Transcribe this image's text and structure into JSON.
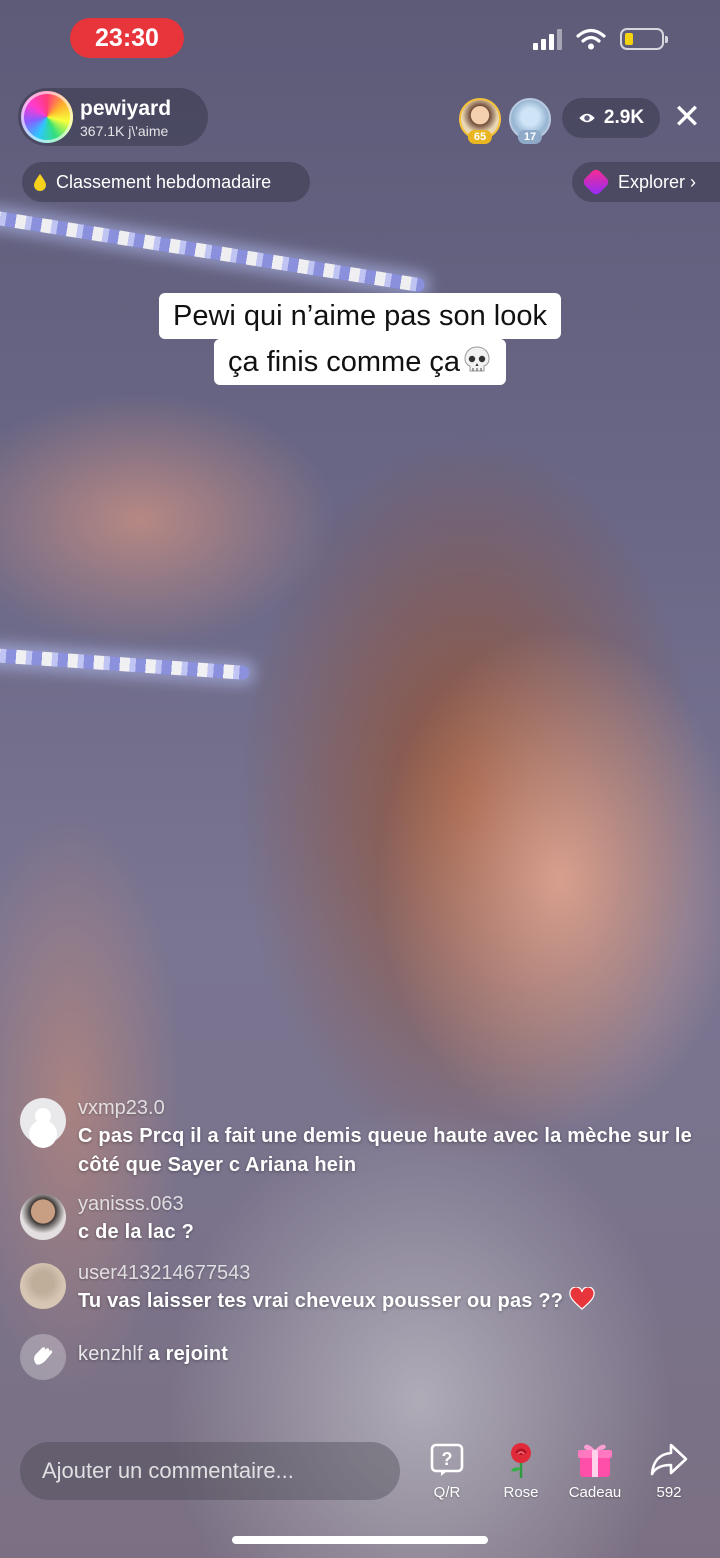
{
  "status_bar": {
    "time": "23:30"
  },
  "host": {
    "name": "pewiyard",
    "likes": "367.1K j\\'aime"
  },
  "top_viewers": [
    {
      "badge": "65"
    },
    {
      "badge": "17"
    }
  ],
  "viewer_count": "2.9K",
  "ranking_label": "Classement hebdomadaire",
  "explore_label": "Explorer ›",
  "caption": {
    "line1": "Pewi qui n’aime pas son look",
    "line2": "ça finis comme ça"
  },
  "comments": [
    {
      "user": "vxmp23.0",
      "text": "C pas Prcq il a fait une demis queue haute avec la mèche sur le côté que Sayer c Ariana hein"
    },
    {
      "user": "yanisss.063",
      "text": "c de la lac ?"
    },
    {
      "user": "user413214677543",
      "text": "Tu vas laisser tes vrai cheveux pousser ou pas ??"
    }
  ],
  "join_event": {
    "user": "kenzhlf",
    "text": "a rejoint"
  },
  "comment_input": {
    "placeholder": "Ajouter un commentaire..."
  },
  "actions": {
    "qr": "Q/R",
    "rose": "Rose",
    "gift": "Cadeau",
    "share_count": "592"
  },
  "colors": {
    "live_red": "#e8343b",
    "battery_low": "#f5d40f",
    "heart": "#e8343b"
  },
  "icons": [
    "signal-icon",
    "wifi-icon",
    "battery-icon",
    "eye-icon",
    "close-icon",
    "drop-icon",
    "explore-icon",
    "skull-icon",
    "heart-icon",
    "wave-icon",
    "question-icon",
    "rose-icon",
    "gift-icon",
    "share-icon"
  ]
}
